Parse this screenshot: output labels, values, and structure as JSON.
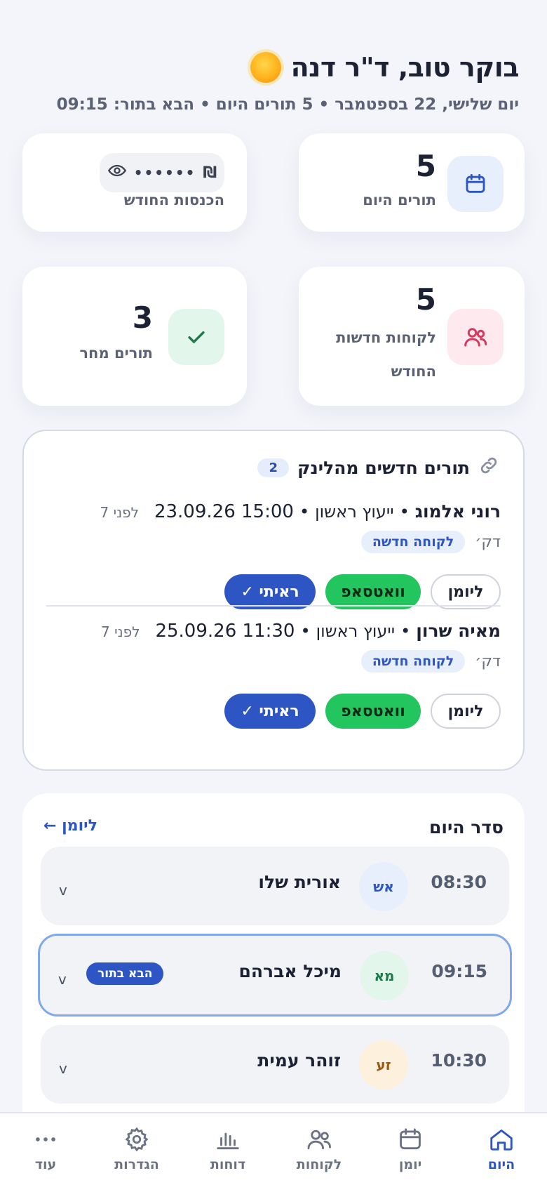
{
  "header": {
    "greeting": "בוקר טוב, ד\"ר דנה",
    "subtitle": "יום שלישי, 22 בספטמבר • 5 תורים היום • הבא בתור: 09:15"
  },
  "stats": {
    "today": {
      "value": "5",
      "label": "תורים היום"
    },
    "income": {
      "masked": "••••••",
      "currency": "₪",
      "label": "הכנסות החודש"
    },
    "new_clients": {
      "value": "5",
      "label_line1": "לקוחות חדשות",
      "label_line2": "החודש"
    },
    "tomorrow": {
      "value": "3",
      "label": "תורים מחר"
    }
  },
  "link_appointments": {
    "title": "תורים חדשים מהלינק",
    "count": "2",
    "items": [
      {
        "name": "רוני אלמוג",
        "service": "ייעוץ ראשון",
        "datetime": "23.09.26 15:00",
        "ago_line1": "לפני 7",
        "ago_line2": "דק׳",
        "badge": "לקוחה חדשה",
        "btn_calendar": "ליומן",
        "btn_whatsapp": "וואטסאפ",
        "btn_seen": "ראיתי ✓"
      },
      {
        "name": "מאיה שרון",
        "service": "ייעוץ ראשון",
        "datetime": "25.09.26 11:30",
        "ago_line1": "לפני 7",
        "ago_line2": "דק׳",
        "badge": "לקוחה חדשה",
        "btn_calendar": "ליומן",
        "btn_whatsapp": "וואטסאפ",
        "btn_seen": "ראיתי ✓"
      }
    ]
  },
  "schedule": {
    "title": "סדר היום",
    "link": "ליומן ←",
    "rows": [
      {
        "time": "08:30",
        "initials": "אש",
        "name": "אורית שלו",
        "avatar_bg": "#e8effc",
        "avatar_fg": "#2d56c4",
        "chevron": "v"
      },
      {
        "time": "09:15",
        "initials": "מא",
        "name": "מיכל אברהם",
        "avatar_bg": "#e3f6ec",
        "avatar_fg": "#1d7a4a",
        "chevron": "v",
        "badge": "הבא בתור"
      },
      {
        "time": "10:30",
        "initials": "זע",
        "name": "זוהר עמית",
        "avatar_bg": "#fdf0dc",
        "avatar_fg": "#9a5a12",
        "chevron": "v"
      }
    ]
  },
  "nav": {
    "items": [
      {
        "label": "היום",
        "icon": "home-icon",
        "active": true
      },
      {
        "label": "יומן",
        "icon": "calendar-icon"
      },
      {
        "label": "לקוחות",
        "icon": "users-icon"
      },
      {
        "label": "דוחות",
        "icon": "bar-chart-icon"
      },
      {
        "label": "הגדרות",
        "icon": "gear-icon"
      },
      {
        "label": "עוד",
        "icon": "more-icon"
      }
    ]
  },
  "colors": {
    "accent": "#2d56c4",
    "whatsapp": "#22c55e",
    "background": "#f3f5fa"
  }
}
